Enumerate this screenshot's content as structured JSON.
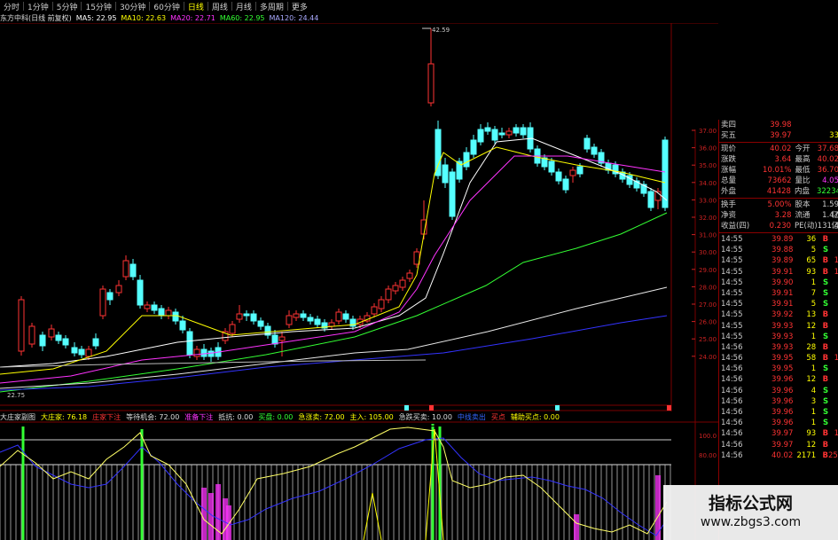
{
  "tabs": [
    {
      "label": "分时",
      "active": false
    },
    {
      "label": "1分钟",
      "active": false
    },
    {
      "label": "5分钟",
      "active": false
    },
    {
      "label": "15分钟",
      "active": false
    },
    {
      "label": "30分钟",
      "active": false
    },
    {
      "label": "60分钟",
      "active": false
    },
    {
      "label": "日线",
      "active": true
    },
    {
      "label": "周线",
      "active": false
    },
    {
      "label": "月线",
      "active": false
    },
    {
      "label": "多周期",
      "active": false
    },
    {
      "label": "更多",
      "active": false
    }
  ],
  "ma_header": {
    "title": "东方中科(日线 前复权)",
    "ma5": "MA5: 22.95",
    "ma10": "MA10: 22.63",
    "ma20": "MA20: 22.71",
    "ma60": "MA60: 22.95",
    "ma120": "MA120: 24.44"
  },
  "price_labels": {
    "high": "42.59",
    "low": "22.75"
  },
  "right_axis": [
    "37.00",
    "36.00",
    "35.00",
    "34.00",
    "33.00",
    "32.00",
    "31.00",
    "30.00",
    "29.00",
    "28.00",
    "27.00",
    "26.00",
    "25.00",
    "24.00"
  ],
  "bottom_axis": [
    "100.0",
    "80.00"
  ],
  "indicator_header": {
    "title": "大庄家副图",
    "items": [
      {
        "text": "大庄家: 76.18",
        "color": "#ffff00"
      },
      {
        "text": "庄家下注",
        "color": "#ff3333"
      },
      {
        "text": "等待机会: 72.00",
        "color": "#dddddd"
      },
      {
        "text": "准备下注",
        "color": "#ff33ff"
      },
      {
        "text": "抵抗: 0.00",
        "color": "#dddddd"
      },
      {
        "text": "买盘: 0.00",
        "color": "#33ff33"
      },
      {
        "text": "急涨卖: 72.00",
        "color": "#ffff00"
      },
      {
        "text": "主入: 105.00",
        "color": "#ffff00"
      },
      {
        "text": "急跌买卖: 10.00",
        "color": "#dddddd"
      },
      {
        "text": "中线卖出",
        "color": "#3366ff"
      },
      {
        "text": "买点",
        "color": "#ff3333"
      },
      {
        "text": "辅助买点: 0.00",
        "color": "#ffff00"
      }
    ]
  },
  "quote_panel": [
    {
      "l": "卖四",
      "v": "39.98",
      "l2": "",
      "v2": "",
      "c": "#ff3333"
    },
    {
      "l": "买五",
      "v": "39.97",
      "l2": "",
      "v2": "33",
      "c": "#ffff00"
    },
    {
      "l": "现价",
      "v": "40.02",
      "l2": "今开",
      "v2": "37.68",
      "c": "#ff3333"
    },
    {
      "l": "涨跌",
      "v": "3.64",
      "l2": "最高",
      "v2": "40.02",
      "c": "#ff3333"
    },
    {
      "l": "涨幅",
      "v": "10.01%",
      "l2": "最低",
      "v2": "36.70",
      "c": "#ff3333"
    },
    {
      "l": "总量",
      "v": "73662",
      "l2": "量比",
      "v2": "4.05",
      "c": "#ff33ff"
    },
    {
      "l": "外盘",
      "v": "41428",
      "l2": "内盘",
      "v2": "32234",
      "c": "#33ff33"
    },
    {
      "l": "换手",
      "v": "5.00%",
      "l2": "股本",
      "v2": "1.59亿",
      "c": "#cccccc"
    },
    {
      "l": "净资",
      "v": "3.28",
      "l2": "流通",
      "v2": "1.47亿",
      "c": "#cccccc"
    },
    {
      "l": "收益(四)",
      "v": "0.230",
      "l2": "PE(动)",
      "v2": "131.4",
      "c": "#cccccc"
    }
  ],
  "ticks": [
    {
      "t": "14:55",
      "p": "39.89",
      "v": "36",
      "d": "B",
      "x": ""
    },
    {
      "t": "14:55",
      "p": "39.88",
      "v": "5",
      "d": "S",
      "x": ""
    },
    {
      "t": "14:55",
      "p": "39.89",
      "v": "65",
      "d": "B",
      "x": "1"
    },
    {
      "t": "14:55",
      "p": "39.91",
      "v": "93",
      "d": "B",
      "x": "1"
    },
    {
      "t": "14:55",
      "p": "39.90",
      "v": "1",
      "d": "S",
      "x": ""
    },
    {
      "t": "14:55",
      "p": "39.91",
      "v": "7",
      "d": "S",
      "x": ""
    },
    {
      "t": "14:55",
      "p": "39.91",
      "v": "5",
      "d": "S",
      "x": ""
    },
    {
      "t": "14:55",
      "p": "39.92",
      "v": "13",
      "d": "B",
      "x": ""
    },
    {
      "t": "14:55",
      "p": "39.93",
      "v": "12",
      "d": "B",
      "x": ""
    },
    {
      "t": "14:55",
      "p": "39.93",
      "v": "1",
      "d": "S",
      "x": ""
    },
    {
      "t": "14:56",
      "p": "39.93",
      "v": "28",
      "d": "B",
      "x": ""
    },
    {
      "t": "14:56",
      "p": "39.95",
      "v": "58",
      "d": "B",
      "x": "1"
    },
    {
      "t": "14:56",
      "p": "39.95",
      "v": "1",
      "d": "S",
      "x": ""
    },
    {
      "t": "14:56",
      "p": "39.96",
      "v": "12",
      "d": "B",
      "x": ""
    },
    {
      "t": "14:56",
      "p": "39.96",
      "v": "4",
      "d": "S",
      "x": ""
    },
    {
      "t": "14:56",
      "p": "39.96",
      "v": "3",
      "d": "S",
      "x": ""
    },
    {
      "t": "14:56",
      "p": "39.96",
      "v": "1",
      "d": "S",
      "x": ""
    },
    {
      "t": "14:56",
      "p": "39.96",
      "v": "1",
      "d": "S",
      "x": ""
    },
    {
      "t": "14:56",
      "p": "39.97",
      "v": "93",
      "d": "B",
      "x": "1"
    },
    {
      "t": "14:56",
      "p": "39.97",
      "v": "12",
      "d": "B",
      "x": ""
    },
    {
      "t": "14:56",
      "p": "40.02",
      "v": "2171",
      "d": "B",
      "x": "250"
    }
  ],
  "watermark": {
    "line1": "指标公式网",
    "line2": "www.zbgs3.com"
  }
}
